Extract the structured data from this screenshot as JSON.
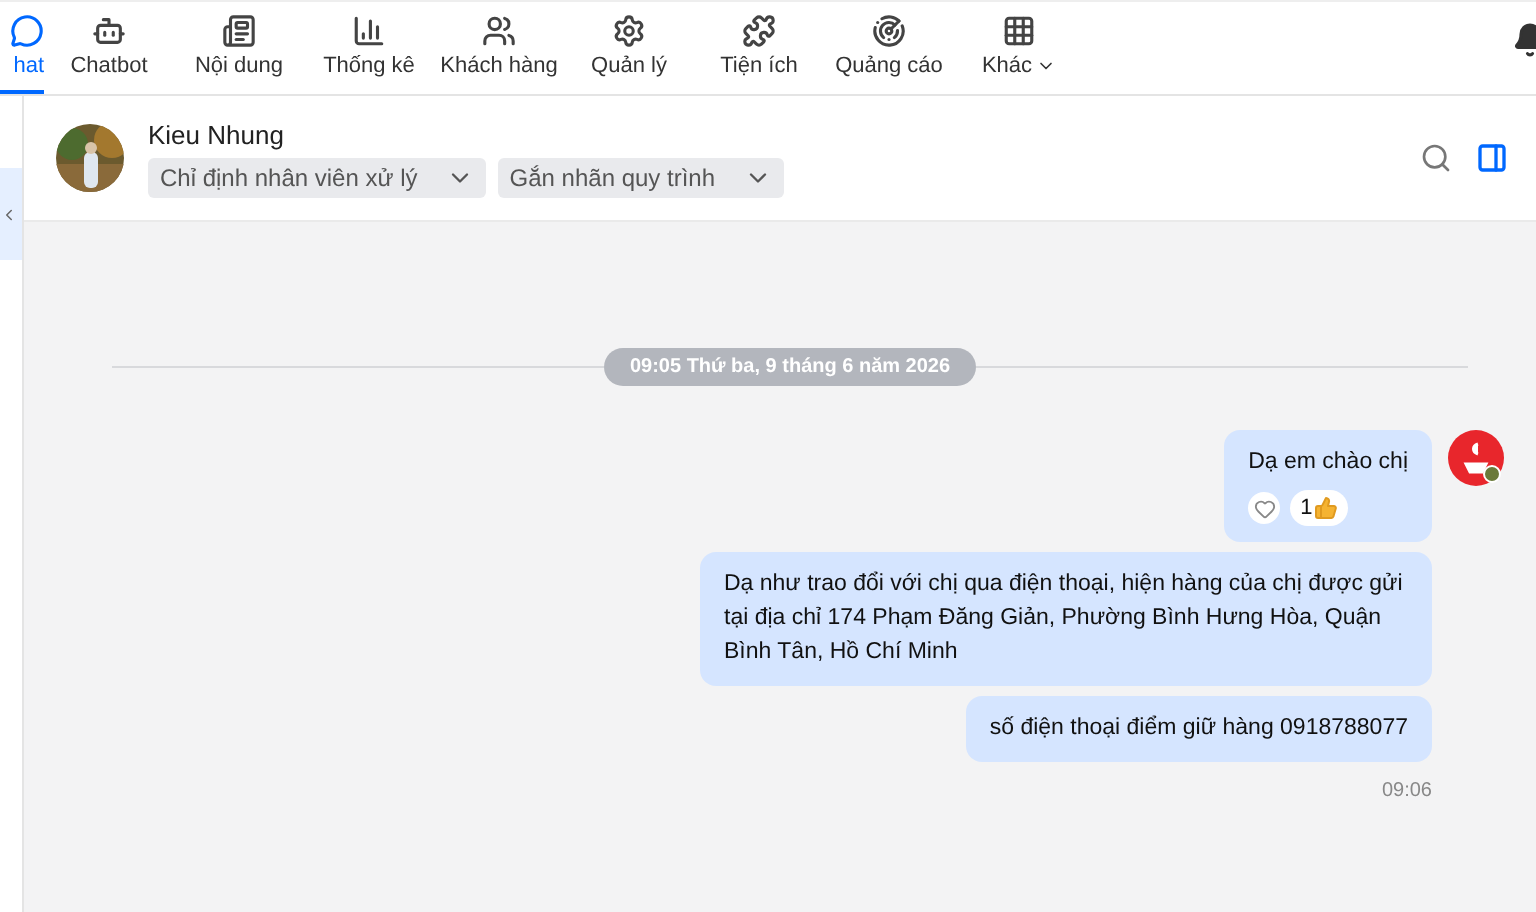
{
  "nav": [
    {
      "label": "hat",
      "selected": true
    },
    {
      "label": "Chatbot",
      "selected": false
    },
    {
      "label": "Nội dung",
      "selected": false
    },
    {
      "label": "Thống kê",
      "selected": false
    },
    {
      "label": "Khách hàng",
      "selected": false
    },
    {
      "label": "Quản lý",
      "selected": false
    },
    {
      "label": "Tiện ích",
      "selected": false
    },
    {
      "label": "Quảng cáo",
      "selected": false
    },
    {
      "label": "Khác",
      "selected": false,
      "dropdown": true
    }
  ],
  "contact": {
    "name": "Kieu Nhung",
    "selects": [
      "Chỉ định nhân viên xử lý",
      "Gắn nhãn quy trình"
    ]
  },
  "date_divider": "09:05 Thứ ba, 9 tháng 6 năm 2026",
  "messages": [
    {
      "text": "Dạ em chào chị",
      "reaction_count": "1"
    },
    {
      "text": "Dạ như trao đổi với chị qua điện thoại, hiện hàng của chị được gửi tại địa chỉ 174 Phạm Đăng Giản, Phường Bình Hưng Hòa, Quận Bình Tân, Hồ Chí Minh"
    },
    {
      "text": "số điện thoại điểm giữ hàng 0918788077"
    }
  ],
  "time": "09:06"
}
